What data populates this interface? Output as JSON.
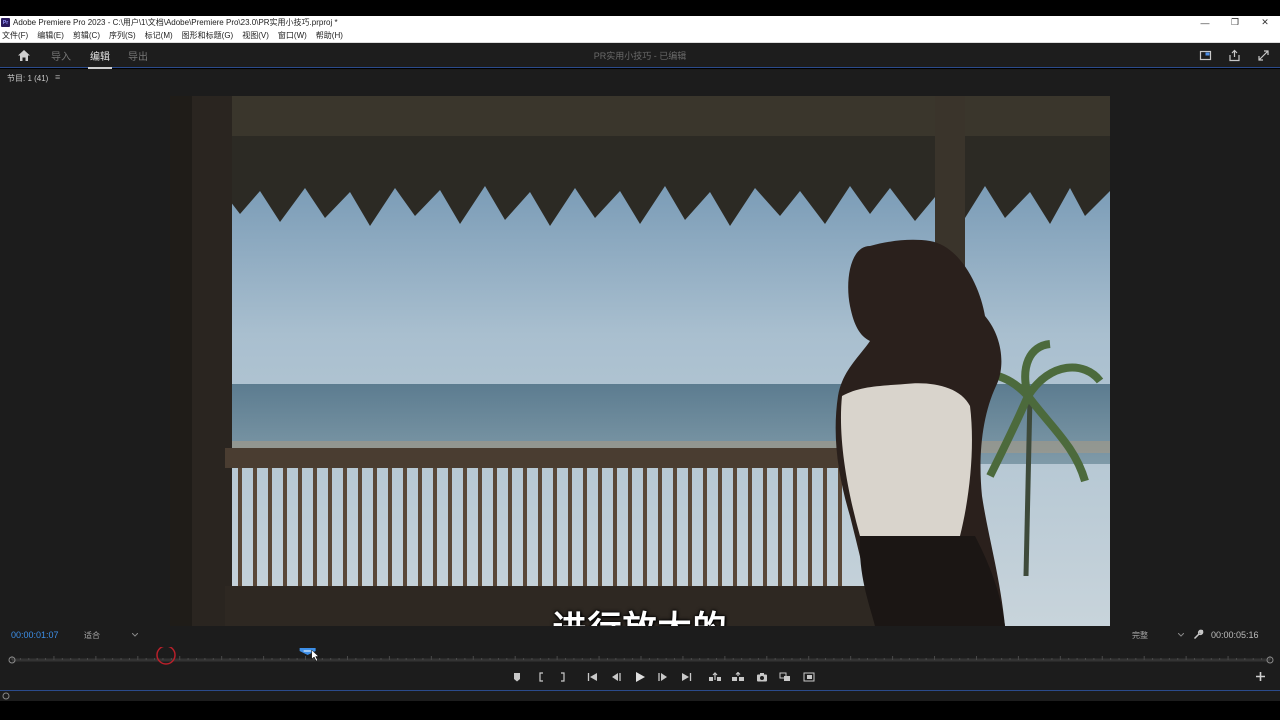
{
  "window": {
    "app_badge": "Pr",
    "title": "Adobe Premiere Pro 2023 - C:\\用户\\1\\文档\\Adobe\\Premiere Pro\\23.0\\PR实用小技巧.prproj *",
    "controls": {
      "minimize": "—",
      "restore": "❐",
      "close": "✕"
    }
  },
  "menu": {
    "items": [
      "文件(F)",
      "编辑(E)",
      "剪辑(C)",
      "序列(S)",
      "标记(M)",
      "图形和标题(G)",
      "视图(V)",
      "窗口(W)",
      "帮助(H)"
    ]
  },
  "header": {
    "tabs": [
      "导入",
      "编辑",
      "导出"
    ],
    "active_tab": "编辑",
    "project_title": "PR实用小技巧 - 已编辑",
    "accent_color": "#2b4b8c"
  },
  "program_monitor": {
    "panel_tab": "节目: 1 (41)",
    "panel_menu": "≡",
    "caption": "进行放大的",
    "current_timecode": "00:00:01:07",
    "fit_value": "适合",
    "quality_value": "完整",
    "duration_timecode": "00:00:05:16",
    "playhead_fraction": 0.235,
    "timecode_color": "#3d8fe8"
  },
  "transport": {
    "icons": [
      "marker-icon",
      "mark-in-icon",
      "mark-out-icon",
      "go-to-in-icon",
      "step-back-icon",
      "play-icon",
      "step-forward-icon",
      "go-to-out-icon",
      "lift-icon",
      "extract-icon",
      "export-frame-icon",
      "insert-icon",
      "overwrite-icon"
    ]
  }
}
